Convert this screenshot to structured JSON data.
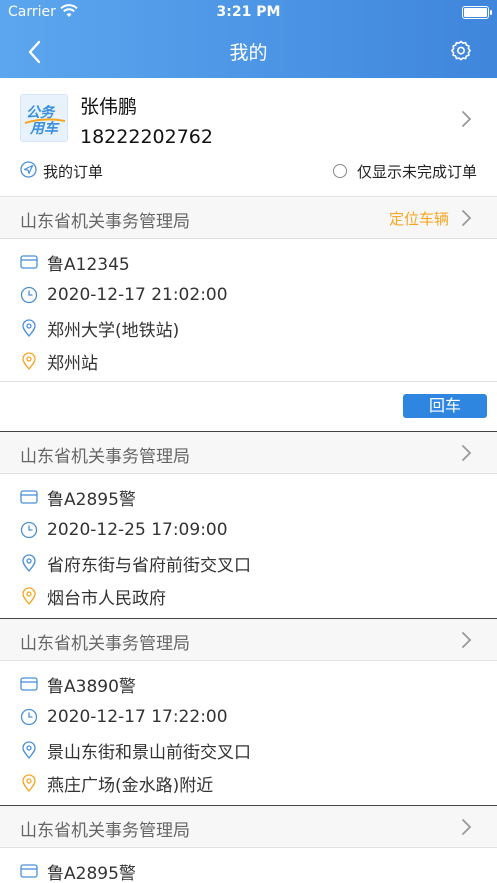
{
  "status_bar": {
    "carrier": "Carrier",
    "time": "3:21 PM"
  },
  "nav": {
    "title": "我的",
    "back_icon": "back-arrow-icon",
    "settings_icon": "gear-icon"
  },
  "profile": {
    "logo_text_top": "公务",
    "logo_text_bottom": "用车",
    "name": "张伟鹏",
    "phone": "18222202762",
    "my_orders_label": "我的订单",
    "filter_label": "仅显示未完成订单",
    "filter_checked": false
  },
  "orders": [
    {
      "org": "山东省机关事务管理局",
      "locate_label": "定位车辆",
      "plate": "鲁A12345",
      "time": "2020-12-17 21:02:00",
      "from": "郑州大学(地铁站)",
      "to": "郑州站",
      "return_label": "回车"
    },
    {
      "org": "山东省机关事务管理局",
      "plate": "鲁A2895警",
      "time": "2020-12-25 17:09:00",
      "from": "省府东街与省府前街交叉口",
      "to": "烟台市人民政府"
    },
    {
      "org": "山东省机关事务管理局",
      "plate": "鲁A3890警",
      "time": "2020-12-17 17:22:00",
      "from": "景山东街和景山前街交叉口",
      "to": "燕庄广场(金水路)附近"
    },
    {
      "org": "山东省机关事务管理局",
      "plate": "鲁A2895警"
    }
  ],
  "colors": {
    "header_start": "#5ca6ef",
    "header_end": "#3f86dc",
    "accent_orange": "#f5a623",
    "button_blue": "#2f86e0",
    "icon_blue": "#4a90d9"
  }
}
